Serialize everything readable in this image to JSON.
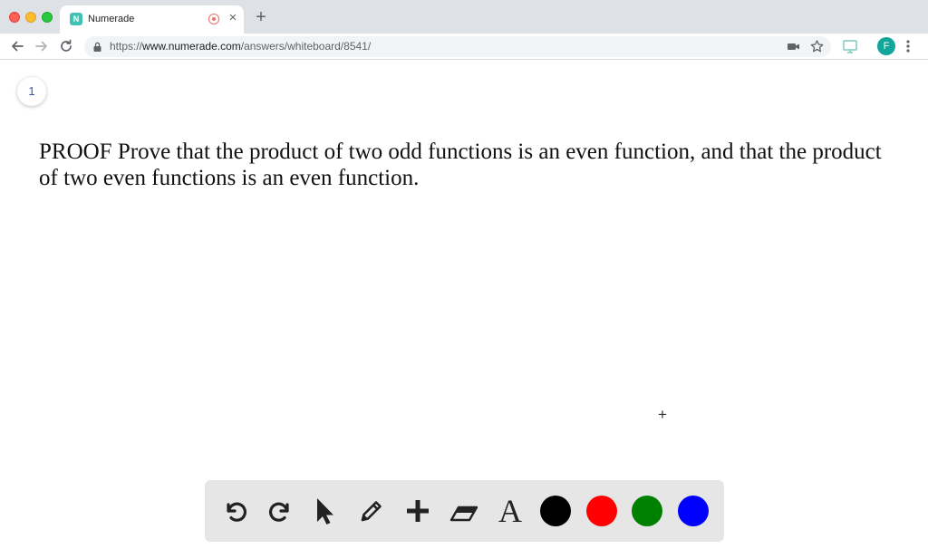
{
  "browser": {
    "tab": {
      "favicon_letter": "N",
      "title": "Numerade"
    },
    "url": {
      "scheme": "https://",
      "host": "www.numerade.com",
      "path": "/answers/whiteboard/8541/"
    },
    "profile_initial": "F"
  },
  "page": {
    "page_number": "1",
    "problem_text": "PROOF Prove that the product of two odd functions is an even function, and that the product of two even functions is an even function."
  },
  "whiteboard": {
    "tools": [
      {
        "name": "undo-icon"
      },
      {
        "name": "redo-icon"
      },
      {
        "name": "pointer-icon"
      },
      {
        "name": "pencil-icon"
      },
      {
        "name": "plus-icon"
      },
      {
        "name": "eraser-icon"
      },
      {
        "name": "text-icon",
        "label": "A"
      }
    ],
    "colors": [
      "#000000",
      "#ff0000",
      "#008000",
      "#0000ff"
    ]
  }
}
